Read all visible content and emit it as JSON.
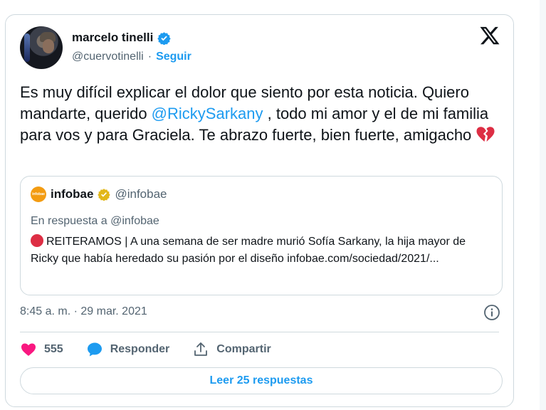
{
  "tweet": {
    "author_name": "marcelo tinelli",
    "author_handle": "@cuervotinelli",
    "separator": "·",
    "follow_label": "Seguir",
    "text_part1": "Es muy difícil explicar el dolor que siento por esta noticia. Quiero mandarte, querido ",
    "mention": "@RickySarkany",
    "text_part2": " , todo mi amor y el de mi familia para vos y para Graciela. Te abrazo fuerte, bien fuerte, amigacho ",
    "timestamp": "8:45 a. m. · 29 mar. 2021",
    "like_count": "555",
    "reply_label": "Responder",
    "share_label": "Compartir",
    "read_replies_label": "Leer 25 respuestas"
  },
  "quoted": {
    "name": "infobae",
    "handle": "@infobae",
    "reply_to": "En respuesta a @infobae",
    "text": "REITERAMOS |  A una semana de ser madre murió Sofía Sarkany, la hija mayor de Ricky que había heredado su pasión por el diseño infobae.com/sociedad/2021/...",
    "avatar_text": "infobae"
  },
  "colors": {
    "accent": "#1d9bf0",
    "like": "#f91880",
    "verified_gold": "#e2b719",
    "muted": "#536471"
  },
  "icons": [
    "verified-badge-icon",
    "x-logo-icon",
    "broken-heart-icon",
    "red-circle-icon",
    "info-icon",
    "heart-icon",
    "comment-bubble-icon",
    "share-icon"
  ]
}
